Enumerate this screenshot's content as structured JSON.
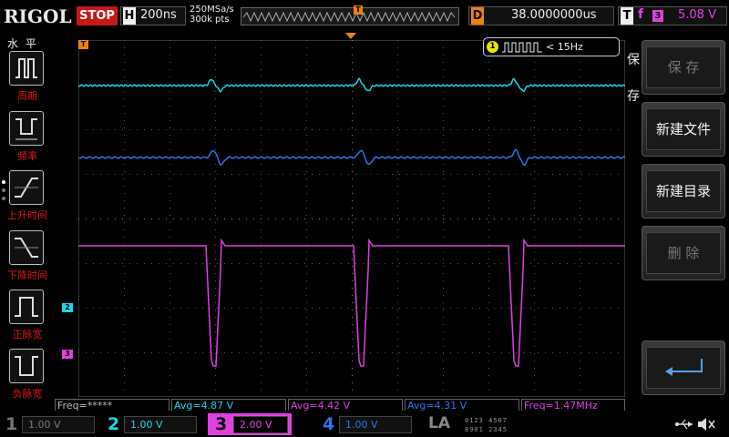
{
  "brand": "RIGOL",
  "run_state": "STOP",
  "horizontal": {
    "letter": "H",
    "timebase": "200ns",
    "sample_rate": "250MSa/s",
    "memory_depth": "300k pts"
  },
  "delay": {
    "letter": "D",
    "value": "38.0000000us"
  },
  "trigger": {
    "letter": "T",
    "edge": "f",
    "source": "3",
    "level": "5.08 V"
  },
  "freq_counter": {
    "channel": "1",
    "text": "< 15Hz"
  },
  "left_menu": {
    "title": "水 平",
    "items": [
      {
        "label": "周期"
      },
      {
        "label": "频率"
      },
      {
        "label": "上升时间"
      },
      {
        "label": "下降时间"
      },
      {
        "label": "正脉宽"
      },
      {
        "label": "负脉宽"
      }
    ]
  },
  "right_menu": {
    "title": "保存",
    "items": [
      {
        "label": "保 存",
        "enabled": false
      },
      {
        "label": "新建文件",
        "enabled": true
      },
      {
        "label": "新建目录",
        "enabled": true
      },
      {
        "label": "删 除",
        "enabled": false
      }
    ],
    "enter_icon": "enter-return-icon"
  },
  "markers": {
    "ch2": "2",
    "ch3": "3",
    "trig_pos": "T",
    "trig_level": "T"
  },
  "measurements": [
    {
      "text": "Freq=*****",
      "color": "#bbbbbb"
    },
    {
      "text": "Avg=4.87 V",
      "color": "#19d7e6"
    },
    {
      "text": "Avg=4.42 V",
      "color": "#e040e0"
    },
    {
      "text": "Avg=4.31 V",
      "color": "#2b74e8"
    },
    {
      "text": "Freq=1.47MHz",
      "color": "#e040e0"
    }
  ],
  "channels": [
    {
      "num": "1",
      "scale": "1.00 V",
      "color": "#777777",
      "active": false
    },
    {
      "num": "2",
      "scale": "1.00 V",
      "color": "#19d7e6",
      "active": true
    },
    {
      "num": "3",
      "scale": "2.00 V",
      "color": "#e040e0",
      "active": true
    },
    {
      "num": "4",
      "scale": "1.00 V",
      "color": "#2b74e8",
      "active": true
    }
  ],
  "la": {
    "label": "LA",
    "bits_row1": "0123 4567",
    "bits_row2": "8901 2345"
  },
  "status_icons": [
    "usb-icon",
    "mute-icon"
  ],
  "colors": {
    "cyan": "#19d7e6",
    "blue": "#2b74e8",
    "magenta": "#e040e0",
    "orange": "#f08010",
    "stop": "#c81818"
  }
}
